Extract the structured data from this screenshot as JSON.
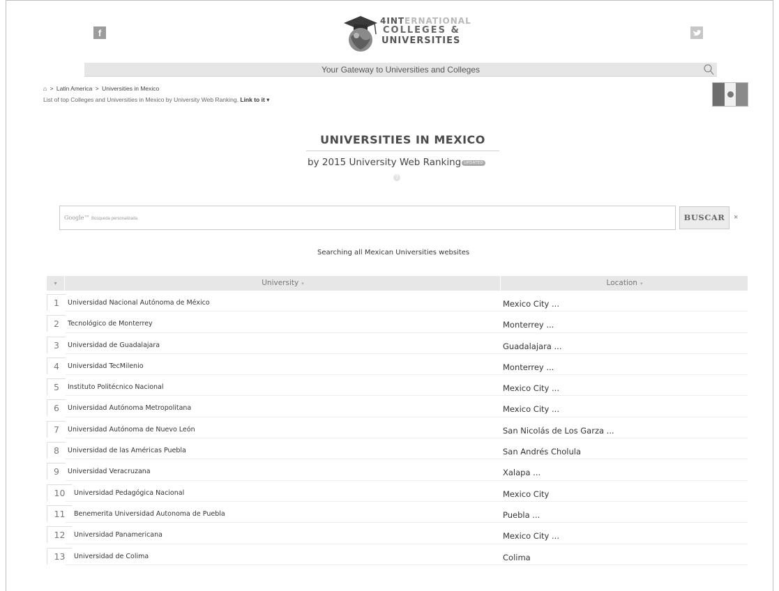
{
  "header": {
    "facebook_glyph": "f",
    "logo_line1_dark": "4INT",
    "logo_line1_light": "ERNATIONAL",
    "logo_line2": "COLLEGES &",
    "logo_line3": "UNIVERSITIES",
    "gateway_text": "Your Gateway to Universities and Colleges"
  },
  "breadcrumb": {
    "home_glyph": "⌂",
    "items": [
      "Latin America",
      "Universities in Mexico"
    ],
    "separator": ">"
  },
  "subtext": {
    "text": "List of top Colleges and Universities in Mexico by University Web Ranking.",
    "link": "Link to it ▾"
  },
  "page": {
    "title": "UNIVERSITIES IN MEXICO",
    "subtitle": "by 2015 University Web Ranking",
    "badge": "UPDATED",
    "help_glyph": "?"
  },
  "search": {
    "google_label": "Google™",
    "google_sub": "Búsqueda personalizada",
    "value": "",
    "button": "BUSCAR",
    "clear": "×",
    "caption": "Searching all Mexican Universities websites"
  },
  "table": {
    "rank_header": "▾",
    "col_university": "University",
    "col_location": "Location",
    "sort_glyph": "▾",
    "rows": [
      {
        "rank": "1",
        "name": "Universidad Nacional Autónoma de México",
        "location": "Mexico City ..."
      },
      {
        "rank": "2",
        "name": "Tecnológico de Monterrey",
        "location": "Monterrey ..."
      },
      {
        "rank": "3",
        "name": "Universidad de Guadalajara",
        "location": "Guadalajara ..."
      },
      {
        "rank": "4",
        "name": "Universidad TecMilenio",
        "location": "Monterrey ..."
      },
      {
        "rank": "5",
        "name": "Instituto Politécnico Nacional",
        "location": "Mexico City ..."
      },
      {
        "rank": "6",
        "name": "Universidad Autónoma Metropolitana",
        "location": "Mexico City ..."
      },
      {
        "rank": "7",
        "name": "Universidad Autónoma de Nuevo León",
        "location": "San Nicolás de Los Garza ..."
      },
      {
        "rank": "8",
        "name": "Universidad de las Américas Puebla",
        "location": "San Andrés Cholula"
      },
      {
        "rank": "9",
        "name": "Universidad Veracruzana",
        "location": "Xalapa ..."
      },
      {
        "rank": "10",
        "name": "Universidad Pedagógica Nacional",
        "location": "Mexico City"
      },
      {
        "rank": "11",
        "name": "Benemerita Universidad Autonoma de Puebla",
        "location": "Puebla ..."
      },
      {
        "rank": "12",
        "name": "Universidad Panamericana",
        "location": "Mexico City ..."
      },
      {
        "rank": "13",
        "name": "Universidad de Colima",
        "location": "Colima"
      }
    ]
  }
}
